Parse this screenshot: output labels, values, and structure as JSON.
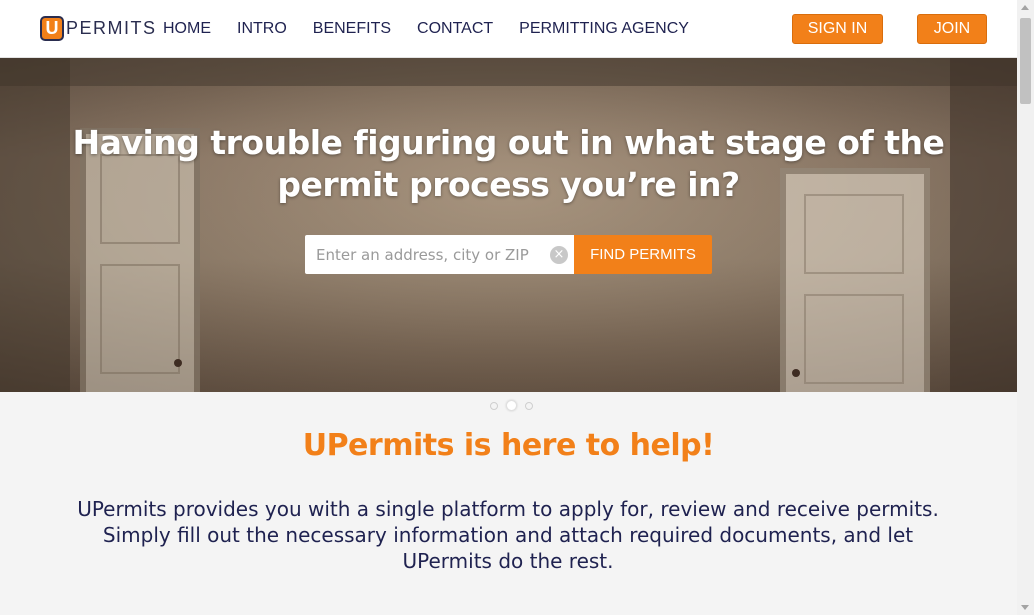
{
  "nav": {
    "logo_letter": "U",
    "logo_text": "PERMITS",
    "links": [
      "HOME",
      "INTRO",
      "BENEFITS",
      "CONTACT",
      "PERMITTING AGENCY"
    ],
    "sign_in": "SIGN IN",
    "join": "JOIN"
  },
  "hero": {
    "title": "Having trouble figuring out in what stage of the permit process you’re in?",
    "search_placeholder": "Enter an address, city or ZIP",
    "search_value": "",
    "clear_glyph": "×",
    "find_button": "FIND PERMITS"
  },
  "carousel": {
    "count": 3,
    "active_index": 1
  },
  "content": {
    "heading": "UPermits is here to help!",
    "body": "UPermits provides you with a single platform to apply for, review and receive permits. Simply fill out the necessary information and attach required documents, and let UPermits do the rest."
  },
  "colors": {
    "accent": "#f28019",
    "navy": "#1f2250",
    "background": "#f4f4f4"
  }
}
